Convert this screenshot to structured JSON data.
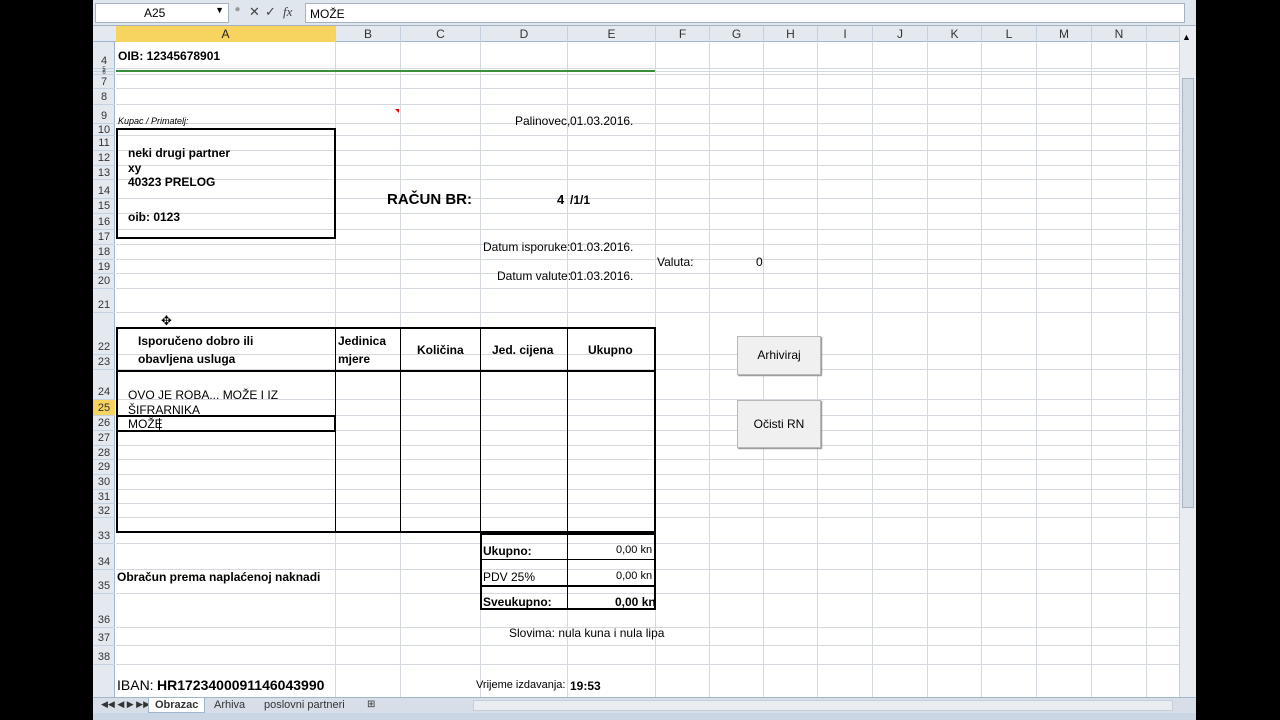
{
  "formula_bar": {
    "name_box": "A25",
    "fx": "fx",
    "cancel": "✕",
    "enter": "✓",
    "content": "MOŽE"
  },
  "columns": [
    "A",
    "B",
    "C",
    "D",
    "E",
    "F",
    "G",
    "H",
    "I",
    "J",
    "K",
    "L",
    "M",
    "N"
  ],
  "rows": [
    "4",
    "5",
    "6",
    "7",
    "8",
    "9",
    "10",
    "11",
    "12",
    "13",
    "14",
    "15",
    "16",
    "17",
    "18",
    "19",
    "20",
    "21",
    "22",
    "23",
    "24",
    "25",
    "26",
    "27",
    "28",
    "29",
    "30",
    "31",
    "32",
    "33",
    "34",
    "35",
    "36",
    "37",
    "38"
  ],
  "invoice": {
    "oib": "OIB: 12345678901",
    "buyer_label": "Kupac / Primatelj:",
    "place": "Palinovec,",
    "date": "01.03.2016.",
    "buyer_name": "neki drugi partner",
    "buyer_addr": "xy",
    "buyer_city": "40323 PRELOG",
    "buyer_oib": "oib: 0123",
    "racun_label": "RAČUN BR:",
    "racun_no": "4",
    "racun_suffix": "/1/1",
    "datum_isporuke_label": "Datum isporuke:",
    "datum_isporuke": "01.03.2016.",
    "valuta_label": "Valuta:",
    "valuta": "0",
    "datum_valute_label": "Datum valute:",
    "datum_valute": "01.03.2016.",
    "col_item": "Isporučeno dobro ili obavljena usluga",
    "col_item_l1": "Isporučeno dobro ili",
    "col_item_l2": "obavljena usluga",
    "col_unit_l1": "Jedinica",
    "col_unit_l2": "mjere",
    "col_qty": "Količina",
    "col_price": "Jed. cijena",
    "col_total": "Ukupno",
    "item_l1": "OVO JE ROBA... MOŽE I IZ",
    "item_l2": "ŠIFRARNIKA",
    "item_edit": "MOŽE",
    "ukupno_label": "Ukupno:",
    "ukupno": "0,00 kn",
    "pdv_label": "PDV 25%",
    "pdv": "0,00 kn",
    "sveukupno_label": "Sveukupno:",
    "sveukupno": "0,00 kn",
    "obracun": "Obračun prema naplaćenoj naknadi",
    "slovima": "Slovima: nula kuna i nula lipa",
    "iban_label": "IBAN:",
    "iban": "HR1723400091146043990",
    "vrijeme_label": "Vrijeme izdavanja:",
    "vrijeme": "19:53"
  },
  "buttons": {
    "archive": "Arhiviraj",
    "clear": "Očisti RN"
  },
  "tabs": [
    "Obrazac",
    "Arhiva",
    "poslovni partneri"
  ]
}
